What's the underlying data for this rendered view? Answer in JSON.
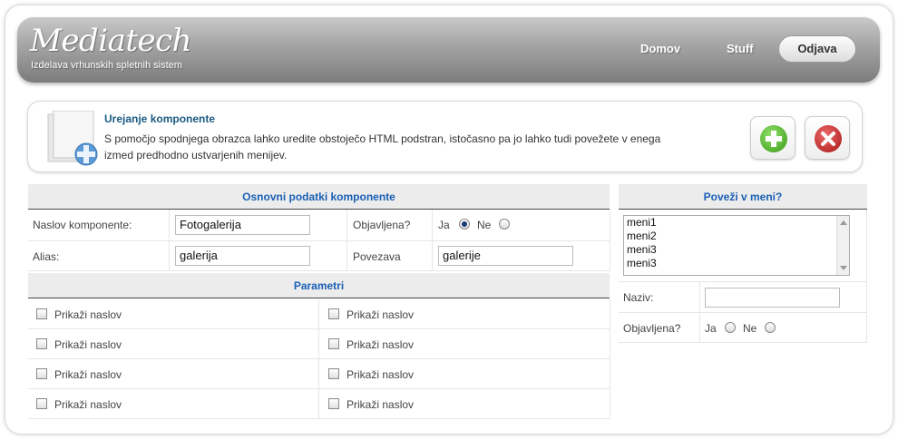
{
  "header": {
    "logo": "Mediatech",
    "tagline": "Izdelava vrhunskih spletnih sistem",
    "nav": [
      "Domov",
      "Stuff"
    ],
    "logout_label": "Odjava"
  },
  "info": {
    "title": "Urejanje komponente",
    "text": "S pomočjo spodnjega obrazca lahko uredite obstoječo HTML podstran, istočasno pa jo lahko tudi povežete v enega izmed predhodno ustvarjenih menijev."
  },
  "basic": {
    "heading": "Osnovni podatki komponente",
    "title_label": "Naslov komponente:",
    "title_value": "Fotogalerija",
    "published_label": "Objavljena?",
    "yes": "Ja",
    "no": "Ne",
    "alias_label": "Alias:",
    "alias_value": "galerija",
    "link_label": "Povezava",
    "link_value": "galerije"
  },
  "params": {
    "heading": "Parametri",
    "option_label": "Prikaži naslov"
  },
  "menu": {
    "heading": "Poveži v meni?",
    "items": [
      "meni1",
      "meni2",
      "meni3",
      "meni3"
    ],
    "name_label": "Naziv:",
    "name_value": "",
    "published_label": "Objavljena?",
    "yes": "Ja",
    "no": "Ne"
  },
  "colors": {
    "heading_text": "#1a5fb4",
    "title_text": "#1b5a82"
  }
}
